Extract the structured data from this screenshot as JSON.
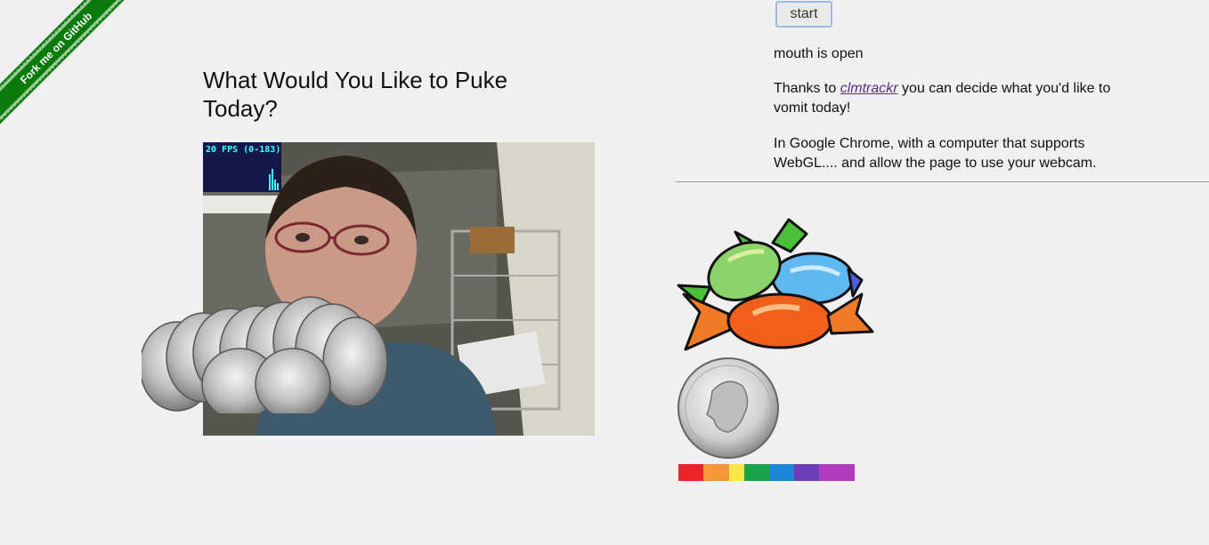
{
  "ribbon": {
    "label": "Fork me on GitHub"
  },
  "page": {
    "title": "What Would You Like to Puke Today?"
  },
  "video": {
    "fps_label": "20 FPS (0-183)"
  },
  "controls": {
    "start_label": "start"
  },
  "status": {
    "text": "mouth is open"
  },
  "description": {
    "p1_before": "Thanks to ",
    "p1_link": "clmtrackr",
    "p1_after": " you can decide what you'd like to vomit today!",
    "p2": "In Google Chrome, with a computer that supports WebGL.... and allow the page to use your webcam."
  },
  "colors": {
    "background": "#f0f0f0",
    "ribbon": "#0a7a0a",
    "link": "#5b2d8a",
    "rainbow": [
      "#e8262a",
      "#f7973a",
      "#f9e64a",
      "#1aa34a",
      "#1c86d9",
      "#6c3fb8",
      "#b03bbd"
    ]
  }
}
